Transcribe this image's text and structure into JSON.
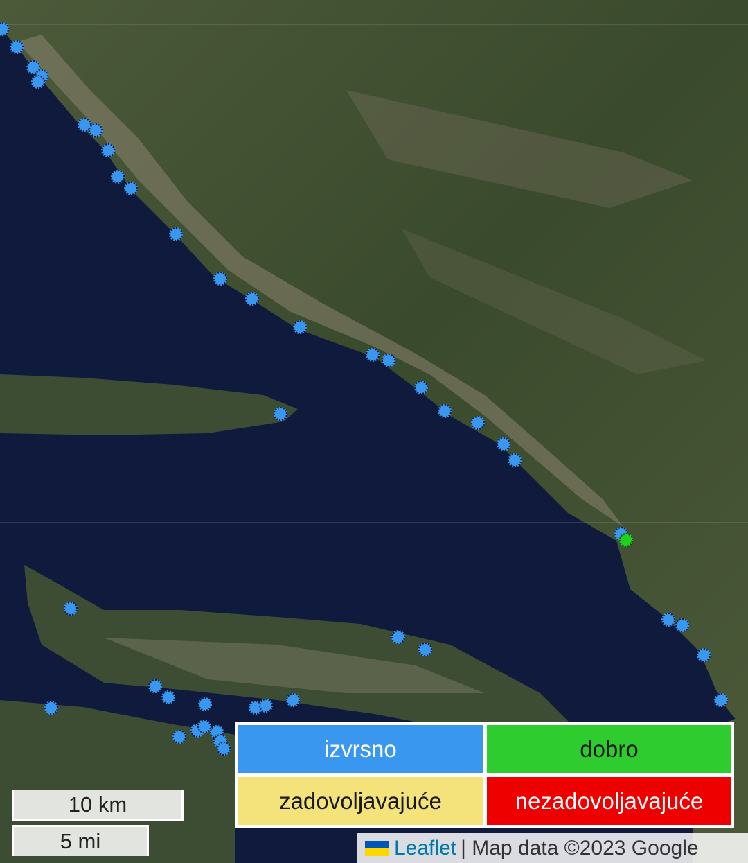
{
  "colors": {
    "excellent": "#3a97f0",
    "good": "#1fd21f",
    "sufficient": "#f4e27a",
    "poor": "#ee0000",
    "sea": "#0f1a3d"
  },
  "legend": [
    {
      "label": "izvrsno",
      "color": "#3a97f0",
      "text_color": "#ffffff"
    },
    {
      "label": "dobro",
      "color": "#2ecc2e",
      "text_color": "#1a1a1a"
    },
    {
      "label": "zadovoljavajuće",
      "color": "#f4e27a",
      "text_color": "#1a1a1a"
    },
    {
      "label": "nezadovoljavajuće",
      "color": "#ee0000",
      "text_color": "#ffffff"
    }
  ],
  "scale": {
    "km": "10 km",
    "mi": "5 mi"
  },
  "attribution": {
    "link": "Leaflet",
    "text": "| Map data ©2023 Google"
  },
  "markers_quality": [
    "izvrsno",
    "izvrsno",
    "izvrsno",
    "izvrsno",
    "izvrsno",
    "izvrsno",
    "izvrsno",
    "izvrsno",
    "izvrsno",
    "izvrsno",
    "izvrsno",
    "izvrsno",
    "izvrsno",
    "izvrsno",
    "izvrsno",
    "izvrsno",
    "izvrsno",
    "izvrsno",
    "izvrsno",
    "izvrsno",
    "izvrsno",
    "izvrsno",
    "izvrsno",
    "izvrsno",
    "izvrsno",
    "izvrsno",
    "dobro",
    "izvrsno",
    "izvrsno",
    "izvrsno",
    "izvrsno",
    "izvrsno",
    "izvrsno",
    "izvrsno",
    "izvrsno",
    "izvrsno",
    "izvrsno",
    "izvrsno",
    "izvrsno",
    "izvrsno",
    "izvrsno",
    "izvrsno",
    "izvrsno",
    "izvrsno",
    "izvrsno",
    "izvrsno"
  ]
}
